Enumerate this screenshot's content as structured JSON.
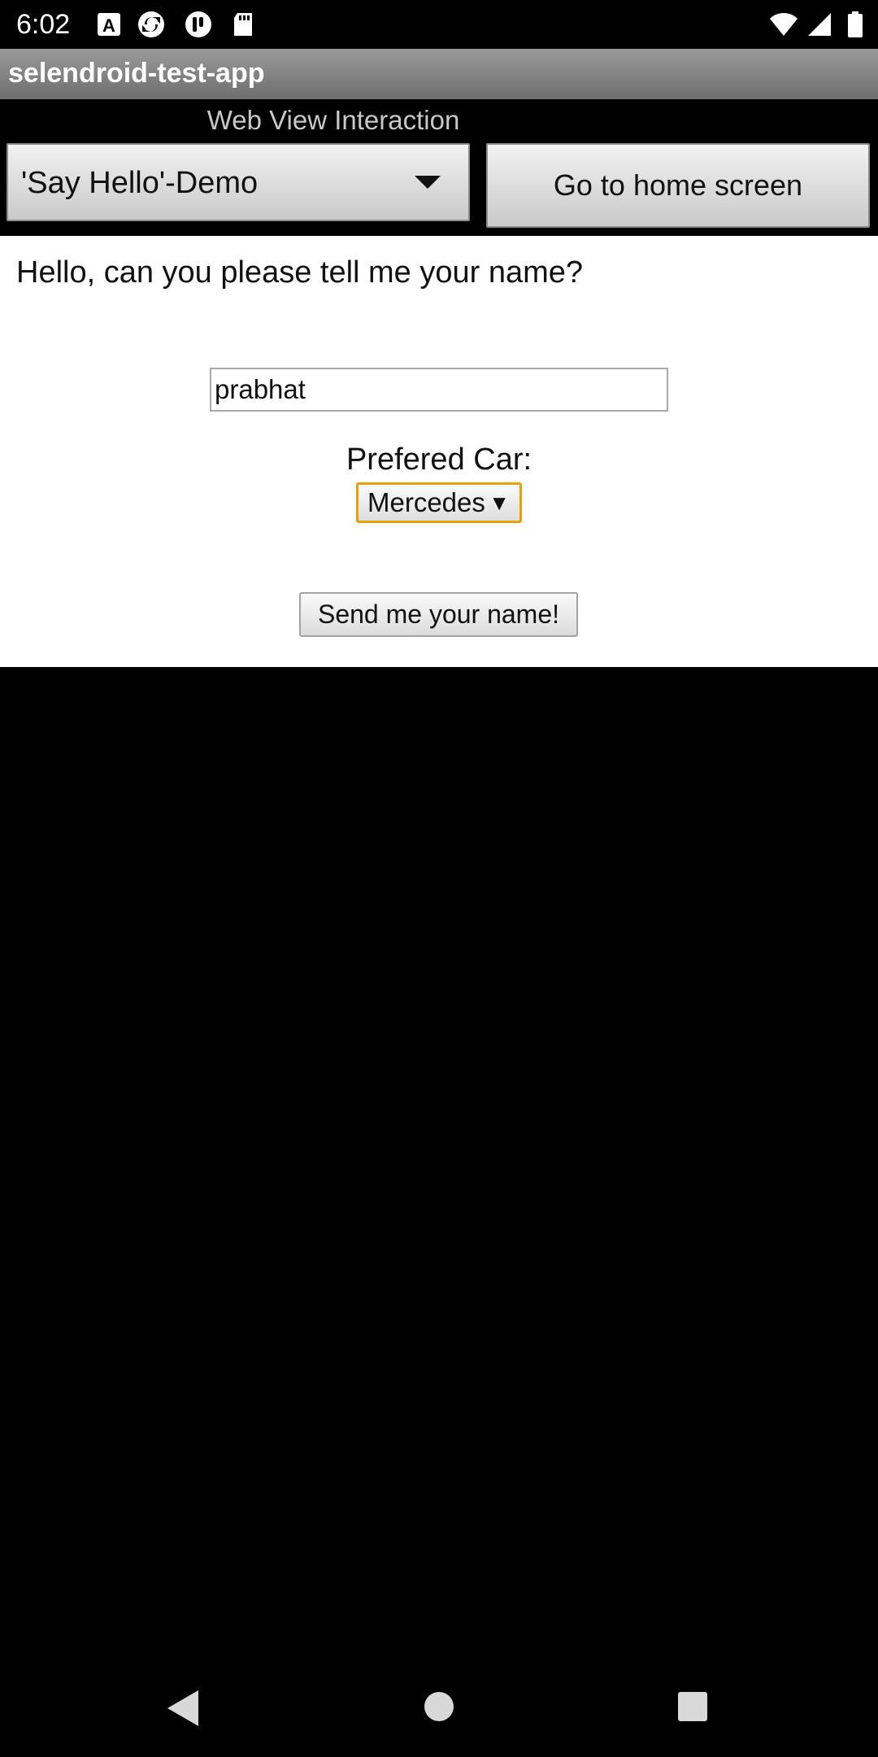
{
  "status_bar": {
    "time": "6:02",
    "icons": [
      "font-app-icon",
      "sync-app-icon",
      "pocket-app-icon",
      "sd-card-icon",
      "wifi-icon",
      "cell-signal-icon",
      "battery-icon"
    ]
  },
  "app": {
    "title": "selendroid-test-app"
  },
  "activity": {
    "label": "Web View Interaction",
    "spinner_selected": "'Say Hello'-Demo",
    "home_button_label": "Go to home screen"
  },
  "web_view": {
    "question": "Hello, can you please tell me your name?",
    "name_input_value": "prabhat",
    "car_label": "Prefered Car:",
    "car_selected": "Mercedes",
    "car_arrow": "▼",
    "send_button_label": "Send me your name!"
  },
  "nav_bar": {
    "buttons": [
      "back",
      "home",
      "recents"
    ]
  },
  "colors": {
    "background": "#000000",
    "webview_background": "#ffffff",
    "select_focus_border": "#e5a00d",
    "title_bar": "#7f7f7f"
  }
}
